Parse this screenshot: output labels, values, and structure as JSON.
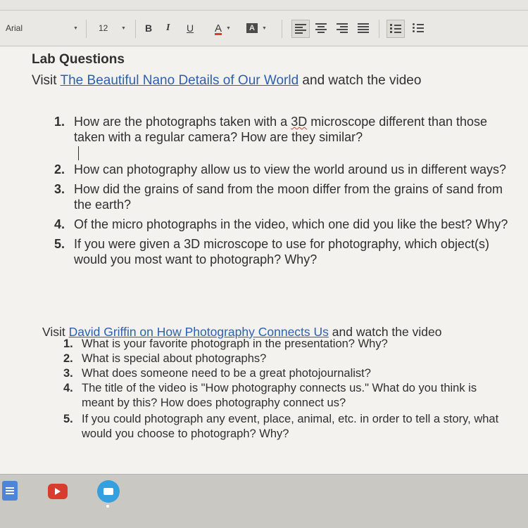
{
  "toolbar": {
    "font_name": "Arial",
    "font_size": "12",
    "bold_label": "B",
    "italic_label": "I",
    "underline_label": "U",
    "text_color_label": "A",
    "highlight_label": "A",
    "text_color_accent": "#e03a2c"
  },
  "document": {
    "heading": "Lab Questions",
    "section1": {
      "prefix": "Visit ",
      "link": "The Beautiful Nano Details of Our World",
      "suffix": " and watch the video",
      "questions": [
        {
          "num": "1.",
          "before": "How are the photographs taken with a ",
          "flagged": "3D",
          "after": " microscope different than those taken with a regular camera? How are they similar?"
        },
        {
          "num": "2.",
          "text": "How can photography allow us to view the world around us in different ways?"
        },
        {
          "num": "3.",
          "text": "How did the grains of sand from the moon differ from the grains of sand from the earth?"
        },
        {
          "num": "4.",
          "text": "Of the micro photographs in the video, which one did you like the best? Why?"
        },
        {
          "num": "5.",
          "text": "If you were given a 3D microscope to use for photography, which object(s) would you most want to photograph? Why?"
        }
      ]
    },
    "section2": {
      "prefix": "Visit ",
      "link": "David Griffin on How Photography Connects Us",
      "suffix": " and watch the video",
      "questions": [
        {
          "num": "1.",
          "text": "What is your favorite photograph in the presentation? Why?"
        },
        {
          "num": "2.",
          "text": "What is special about photographs?"
        },
        {
          "num": "3.",
          "text": "What does someone need to be a great photojournalist?"
        },
        {
          "num": "4.",
          "text": "The title of the video is \"How photography connects us.\" What do you think is meant by this? How does photography connect us?"
        },
        {
          "num": "5.",
          "text": "If you could photograph any event, place, animal, etc. in order to tell a story, what would you choose to photograph? Why?"
        }
      ]
    }
  },
  "taskbar": {
    "apps": [
      "docs-icon",
      "youtube-icon",
      "files-icon"
    ]
  }
}
